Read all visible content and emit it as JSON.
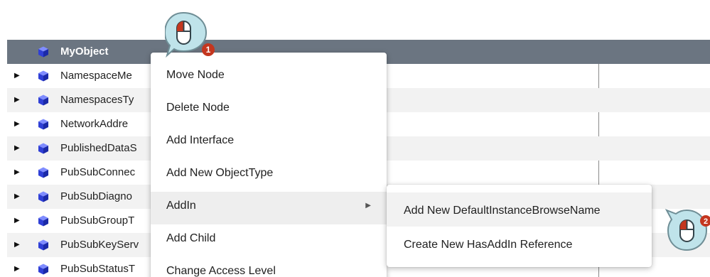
{
  "tree": {
    "rows": [
      {
        "label": "MyObject"
      },
      {
        "label": "NamespaceMe"
      },
      {
        "label": "NamespacesTy"
      },
      {
        "label": "NetworkAddre"
      },
      {
        "label": "PublishedDataS"
      },
      {
        "label": "PubSubConnec"
      },
      {
        "label": "PubSubDiagno"
      },
      {
        "label": "PubSubGroupT"
      },
      {
        "label": "PubSubKeyServ"
      },
      {
        "label": "PubSubStatusT"
      }
    ]
  },
  "context_menu": {
    "items": [
      {
        "label": "Move Node"
      },
      {
        "label": "Delete Node"
      },
      {
        "label": "Add Interface"
      },
      {
        "label": "Add New ObjectType"
      },
      {
        "label": "AddIn"
      },
      {
        "label": "Add Child"
      },
      {
        "label": "Change Access Level"
      }
    ]
  },
  "submenu": {
    "items": [
      {
        "label": "Add New DefaultInstanceBrowseName"
      },
      {
        "label": "Create New HasAddIn Reference"
      }
    ]
  },
  "callouts": [
    {
      "number": "1",
      "icon": "mouse-left-click-icon"
    },
    {
      "number": "2",
      "icon": "mouse-left-click-icon"
    }
  ],
  "colors": {
    "selected_row": "#6b7581",
    "cube_blue": "#3a4ee0",
    "callout_teal": "#bfe3ea",
    "badge_red": "#c4361f"
  }
}
